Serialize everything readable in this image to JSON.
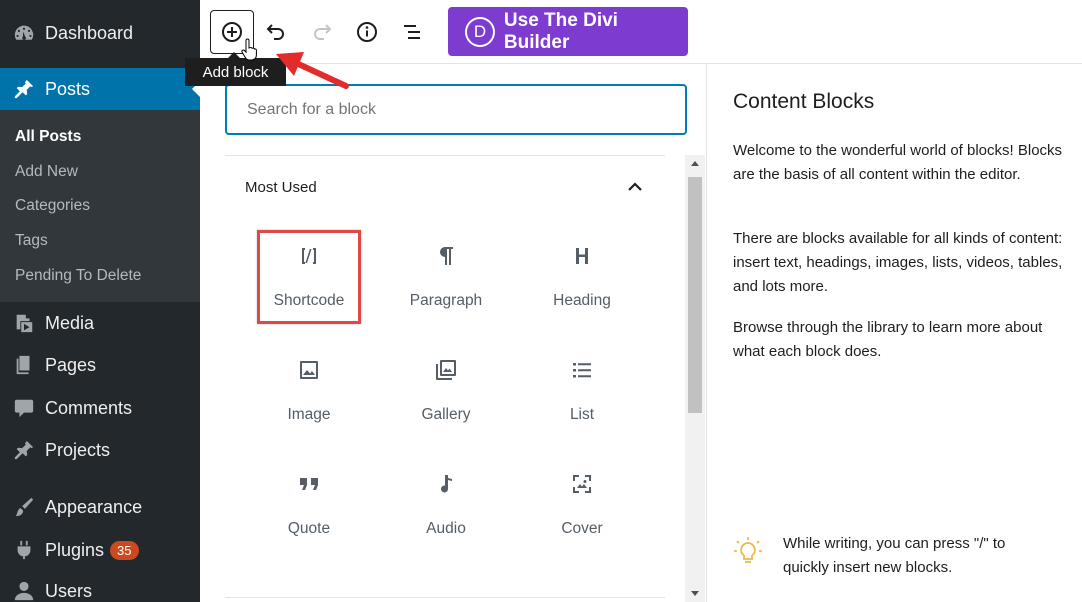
{
  "sidebar": {
    "items": [
      {
        "label": "Dashboard",
        "icon": "dashboard-icon"
      },
      {
        "label": "Posts",
        "icon": "pin-icon"
      },
      {
        "label": "Media",
        "icon": "media-icon"
      },
      {
        "label": "Pages",
        "icon": "pages-icon"
      },
      {
        "label": "Comments",
        "icon": "comments-icon"
      },
      {
        "label": "Projects",
        "icon": "pin-icon"
      },
      {
        "label": "Appearance",
        "icon": "brush-icon"
      },
      {
        "label": "Plugins",
        "icon": "plugins-icon",
        "badge": "35"
      },
      {
        "label": "Users",
        "icon": "users-icon"
      }
    ],
    "submenu": [
      "All Posts",
      "Add New",
      "Categories",
      "Tags",
      "Pending To Delete"
    ]
  },
  "toolbar": {
    "divi_label": "Use The Divi Builder",
    "divi_logo": "D",
    "tooltip": "Add block"
  },
  "inserter": {
    "search_placeholder": "Search for a block",
    "section_title": "Most Used",
    "blocks": [
      {
        "label": "Shortcode",
        "icon": "shortcode-icon"
      },
      {
        "label": "Paragraph",
        "icon": "paragraph-icon"
      },
      {
        "label": "Heading",
        "icon": "heading-icon"
      },
      {
        "label": "Image",
        "icon": "image-icon"
      },
      {
        "label": "Gallery",
        "icon": "gallery-icon"
      },
      {
        "label": "List",
        "icon": "list-icon"
      },
      {
        "label": "Quote",
        "icon": "quote-icon"
      },
      {
        "label": "Audio",
        "icon": "audio-icon"
      },
      {
        "label": "Cover",
        "icon": "cover-icon"
      }
    ]
  },
  "info": {
    "title": "Content Blocks",
    "p1": "Welcome to the wonderful world of blocks! Blocks are the basis of all content within the editor.",
    "p2": "There are blocks available for all kinds of content: insert text, headings, images, lists, videos, tables, and lots more.",
    "p3": "Browse through the library to learn more about what each block does.",
    "tip": "While writing, you can press \"/\" to quickly insert new blocks."
  },
  "colors": {
    "sidebar": "#23282d",
    "active": "#0073aa",
    "divi": "#7e3bd0",
    "focus": "#007cba",
    "highlight": "#e04848"
  }
}
